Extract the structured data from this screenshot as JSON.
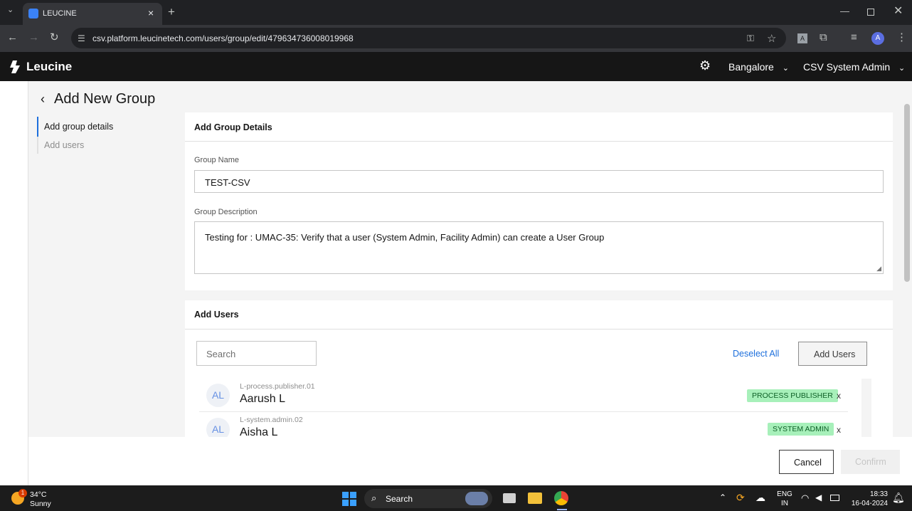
{
  "browser": {
    "tab_title": "LEUCINE",
    "url": "csv.platform.leucinetech.com/users/group/edit/479634736008019968",
    "profile_initial": "A"
  },
  "header": {
    "brand": "Leucine",
    "location": "Bangalore",
    "role": "CSV System Admin"
  },
  "page": {
    "title": "Add New Group",
    "steps": [
      {
        "label": "Add group details",
        "active": true
      },
      {
        "label": "Add users",
        "active": false
      }
    ]
  },
  "details": {
    "section_title": "Add Group Details",
    "name_label": "Group Name",
    "name_value": "TEST-CSV",
    "desc_label": "Group Description",
    "desc_value": "Testing for : UMAC-35: Verify that a user (System Admin, Facility Admin) can create a User Group"
  },
  "users": {
    "section_title": "Add Users",
    "search_placeholder": "Search",
    "deselect_label": "Deselect All",
    "add_label": "Add Users",
    "list": [
      {
        "initials": "AL",
        "username": "L-process.publisher.01",
        "name": "Aarush L",
        "role": "PROCESS PUBLISHER"
      },
      {
        "initials": "AL",
        "username": "L-system.admin.02",
        "name": "Aisha L",
        "role": "SYSTEM ADMIN"
      }
    ]
  },
  "footer": {
    "cancel_label": "Cancel",
    "confirm_label": "Confirm"
  },
  "taskbar": {
    "temp": "34°C",
    "weather": "Sunny",
    "weather_badge": "1",
    "search_label": "Search",
    "lang_top": "ENG",
    "lang_bottom": "IN",
    "time": "18:33",
    "date": "16-04-2024"
  },
  "colors": {
    "accent": "#1d6fdc",
    "badge_bg": "#a7f0ba",
    "badge_fg": "#0e6027",
    "header_bg": "#161616"
  }
}
